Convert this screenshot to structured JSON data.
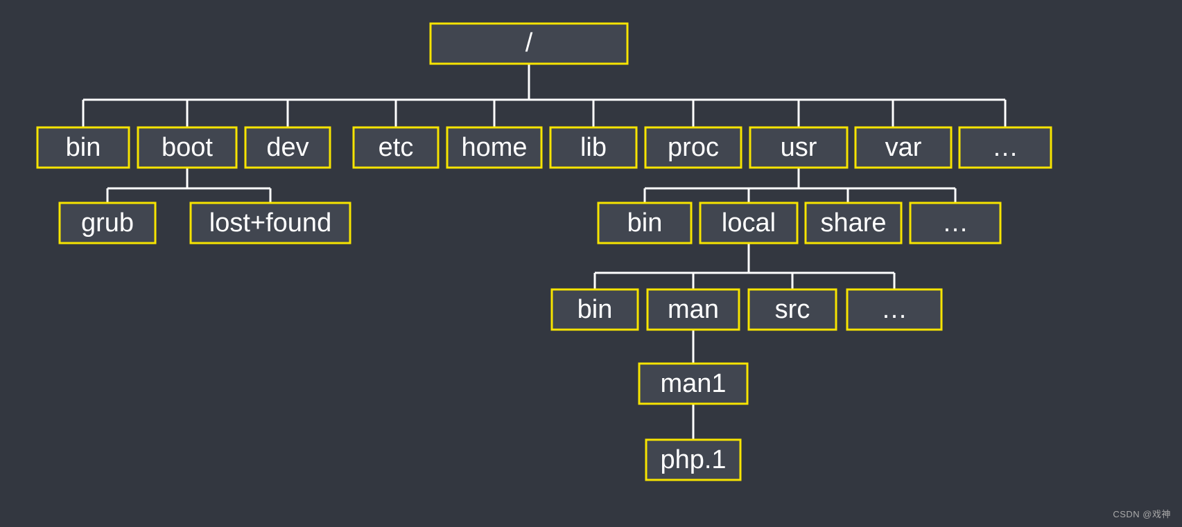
{
  "watermark": "CSDN @戏神",
  "tree": {
    "root": {
      "label": "/"
    },
    "level1": [
      {
        "id": "bin",
        "label": "bin"
      },
      {
        "id": "boot",
        "label": "boot"
      },
      {
        "id": "dev",
        "label": "dev"
      },
      {
        "id": "etc",
        "label": "etc"
      },
      {
        "id": "home",
        "label": "home"
      },
      {
        "id": "lib",
        "label": "lib"
      },
      {
        "id": "proc",
        "label": "proc"
      },
      {
        "id": "usr",
        "label": "usr"
      },
      {
        "id": "var",
        "label": "var"
      },
      {
        "id": "more1",
        "label": "…"
      }
    ],
    "boot_children": [
      {
        "id": "grub",
        "label": "grub"
      },
      {
        "id": "lostfound",
        "label": "lost+found"
      }
    ],
    "usr_children": [
      {
        "id": "usr_bin",
        "label": "bin"
      },
      {
        "id": "usr_local",
        "label": "local"
      },
      {
        "id": "usr_share",
        "label": "share"
      },
      {
        "id": "usr_more",
        "label": "…"
      }
    ],
    "local_children": [
      {
        "id": "local_bin",
        "label": "bin"
      },
      {
        "id": "local_man",
        "label": "man"
      },
      {
        "id": "local_src",
        "label": "src"
      },
      {
        "id": "local_more",
        "label": "…"
      }
    ],
    "man_children": [
      {
        "id": "man1",
        "label": "man1"
      }
    ],
    "man1_children": [
      {
        "id": "php1",
        "label": "php.1"
      }
    ]
  }
}
